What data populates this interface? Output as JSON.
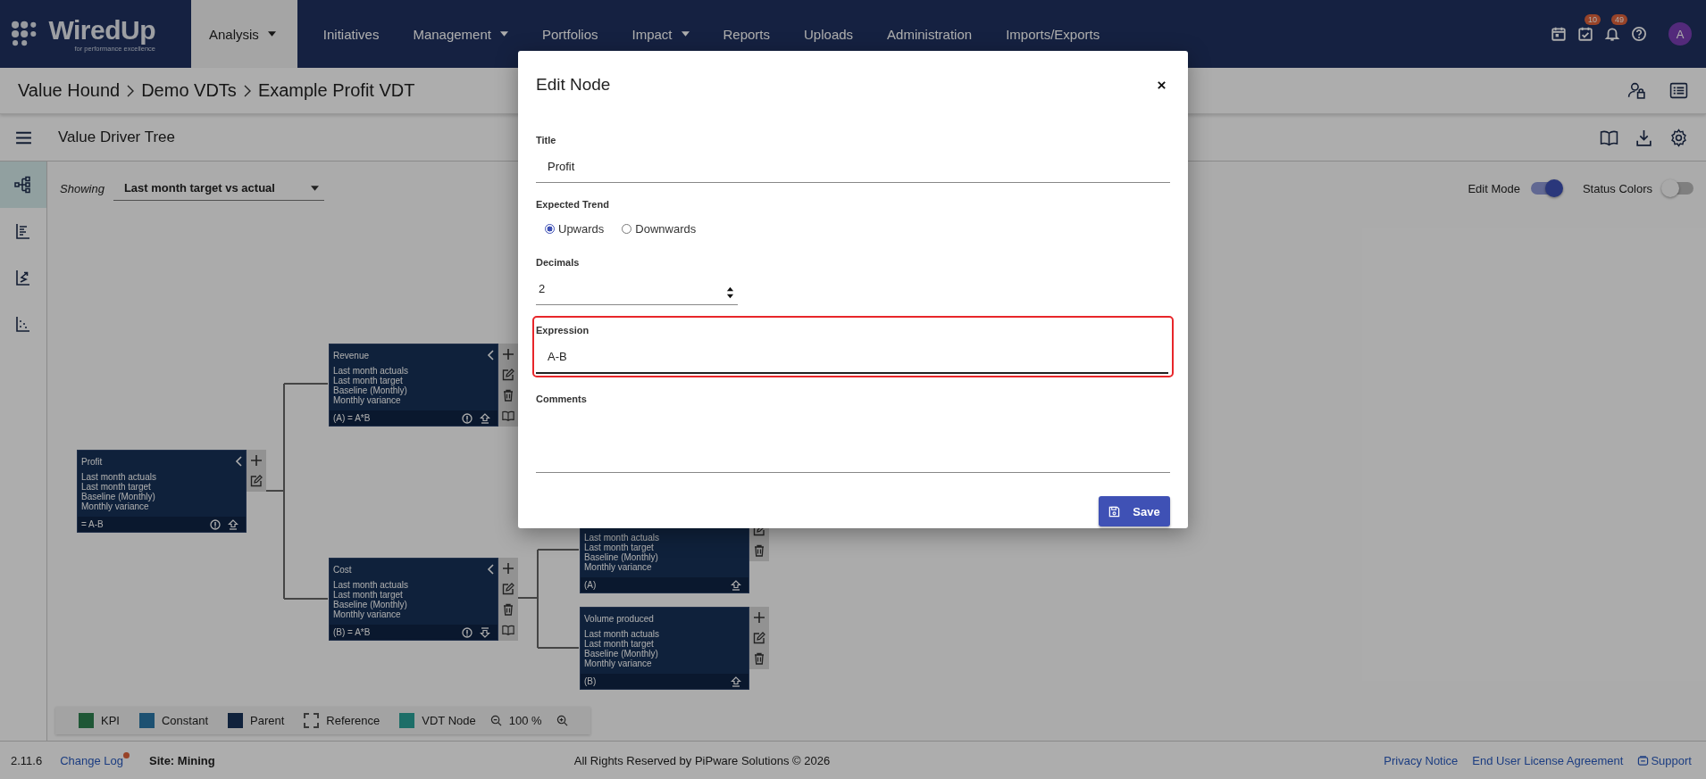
{
  "nav": {
    "logo": {
      "name": "WiredUp",
      "tagline": "for performance excellence"
    },
    "items": [
      {
        "label": "Analysis",
        "dropdown": true,
        "selected": true
      },
      {
        "label": "Initiatives",
        "dropdown": false,
        "selected": false
      },
      {
        "label": "Management",
        "dropdown": true,
        "selected": false
      },
      {
        "label": "Portfolios",
        "dropdown": false,
        "selected": false
      },
      {
        "label": "Impact",
        "dropdown": true,
        "selected": false
      },
      {
        "label": "Reports",
        "dropdown": false,
        "selected": false
      },
      {
        "label": "Uploads",
        "dropdown": false,
        "selected": false
      },
      {
        "label": "Administration",
        "dropdown": false,
        "selected": false
      },
      {
        "label": "Imports/Exports",
        "dropdown": false,
        "selected": false
      }
    ],
    "icons": [
      {
        "kind": "calendar"
      },
      {
        "kind": "tasks",
        "badge": "10"
      },
      {
        "kind": "bell",
        "badge": "49"
      },
      {
        "kind": "help"
      }
    ],
    "avatar": "A"
  },
  "breadcrumb": [
    "Value Hound",
    "Demo VDTs",
    "Example Profit VDT"
  ],
  "toolbar": {
    "title": "Value Driver Tree"
  },
  "sidebar": {
    "items": [
      {
        "kind": "tree",
        "selected": true
      },
      {
        "kind": "list",
        "selected": false
      },
      {
        "kind": "trend",
        "selected": false
      },
      {
        "kind": "scatter",
        "selected": false
      }
    ]
  },
  "showing": {
    "label": "Showing",
    "value": "Last month target vs actual"
  },
  "toggles": [
    {
      "label": "Edit Mode",
      "on": true
    },
    {
      "label": "Status Colors",
      "on": false
    }
  ],
  "tree": {
    "nodes": [
      {
        "title": "Profit",
        "lines": [
          "Last month actuals",
          "Last month target",
          "Baseline (Monthly)",
          "Monthly variance"
        ],
        "formula": "= A-B",
        "collapsible": true,
        "footer_icons": [
          {
            "kind": "info"
          },
          {
            "kind": "arrow_up"
          }
        ],
        "actions": [
          {
            "kind": "add"
          },
          {
            "kind": "edit"
          }
        ],
        "children": [
          {
            "title": "Revenue",
            "lines": [
              "Last month actuals",
              "Last month target",
              "Baseline (Monthly)",
              "Monthly variance"
            ],
            "formula": "(A) = A*B",
            "collapsible": true,
            "footer_icons": [
              {
                "kind": "info"
              },
              {
                "kind": "arrow_up"
              }
            ],
            "actions": [
              {
                "kind": "add"
              },
              {
                "kind": "edit"
              },
              {
                "kind": "delete"
              },
              {
                "kind": "book"
              }
            ]
          },
          {
            "title": "Cost",
            "lines": [
              "Last month actuals",
              "Last month target",
              "Baseline (Monthly)",
              "Monthly variance"
            ],
            "formula": "(B) = A*B",
            "collapsible": true,
            "footer_icons": [
              {
                "kind": "info"
              },
              {
                "kind": "arrow_down"
              }
            ],
            "actions": [
              {
                "kind": "add"
              },
              {
                "kind": "edit"
              },
              {
                "kind": "delete"
              },
              {
                "kind": "book"
              }
            ],
            "children": [
              {
                "lines": [
                  "Last month actuals",
                  "Last month target",
                  "Baseline (Monthly)",
                  "Monthly variance"
                ],
                "formula": "(A)",
                "collapsible": false,
                "footer_icons": [
                  {
                    "kind": "arrow_up"
                  }
                ],
                "actions": [
                  {
                    "kind": "edit"
                  },
                  {
                    "kind": "delete"
                  }
                ]
              },
              {
                "title": "Volume produced",
                "lines": [
                  "Last month actuals",
                  "Last month target",
                  "Baseline (Monthly)",
                  "Monthly variance"
                ],
                "formula": "(B)",
                "collapsible": false,
                "footer_icons": [
                  {
                    "kind": "arrow_up"
                  }
                ],
                "actions": [
                  {
                    "kind": "add"
                  },
                  {
                    "kind": "edit"
                  },
                  {
                    "kind": "delete"
                  }
                ]
              }
            ]
          }
        ]
      }
    ]
  },
  "legend": {
    "items": [
      {
        "label": "KPI",
        "kind": "fill",
        "color": "#1f5736"
      },
      {
        "label": "Constant",
        "kind": "fill",
        "color": "#1d5172"
      },
      {
        "label": "Parent",
        "kind": "fill",
        "color": "#10223c"
      },
      {
        "label": "Reference",
        "kind": "dashed",
        "color": "#3a3a3a"
      },
      {
        "label": "VDT Node",
        "kind": "fill",
        "color": "#1d6e68"
      }
    ],
    "zoom": "100 %"
  },
  "footer": {
    "version": "2.11.6",
    "changelog": {
      "label": "Change Log",
      "dot": true
    },
    "site": "Site: Mining",
    "copyright": "All Rights Reserved by PiPware Solutions © 2026",
    "links": [
      "Privacy Notice",
      "End User License Agreement"
    ],
    "support": "Support"
  },
  "dialog": {
    "title": "Edit Node",
    "fields": [
      {
        "kind": "text",
        "label": "Title",
        "value": "Profit",
        "highlighted": false
      },
      {
        "kind": "radio",
        "label": "Expected Trend",
        "options": [
          {
            "label": "Upwards",
            "selected": true
          },
          {
            "label": "Downwards",
            "selected": false
          }
        ]
      },
      {
        "kind": "number",
        "label": "Decimals",
        "value": "2"
      },
      {
        "kind": "text",
        "label": "Expression",
        "value": "A-B",
        "highlighted": true
      },
      {
        "kind": "textarea",
        "label": "Comments"
      }
    ],
    "save": "Save"
  }
}
